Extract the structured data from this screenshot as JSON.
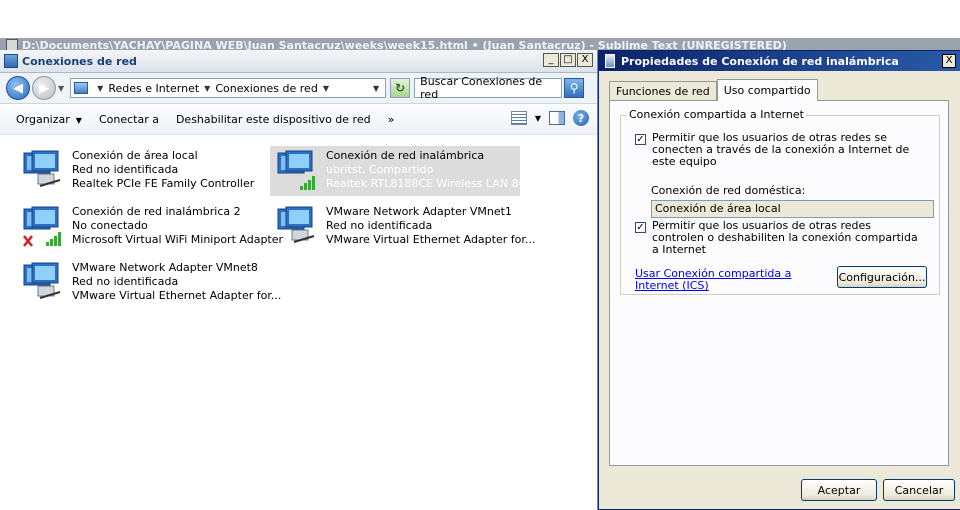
{
  "sublime": {
    "title": "D:\\Documents\\YACHAY\\PAGINA WEB\\Juan Santacruz\\weeks\\week15.html • (Juan Santacruz) - Sublime Text (UNREGISTERED)"
  },
  "explorer": {
    "title": "Conexiones de red",
    "window_buttons": {
      "minimize": "_",
      "maximize": "□",
      "close": "X"
    },
    "breadcrumb": [
      "Redes e Internet",
      "Conexiones de red"
    ],
    "search": {
      "placeholder": "Buscar Conexiones de red"
    },
    "toolbar": {
      "organize": "Organizar",
      "connect": "Conectar a",
      "disable": "Deshabilitar este dispositivo de red",
      "more": "»"
    },
    "connections": [
      {
        "name": "Conexión de área local",
        "status": "Red no identificada",
        "adapter": "Realtek PCIe FE Family Controller",
        "selected": false,
        "icon": "wired-network-icon"
      },
      {
        "name": "Conexión de red inalámbrica",
        "status": "ubritst, Compartido",
        "adapter": "Realtek RTL8188CE Wireless LAN 80...",
        "selected": true,
        "icon": "wireless-network-icon"
      },
      {
        "name": "Conexión de red inalámbrica 2",
        "status": "No conectado",
        "adapter": "Microsoft Virtual WiFi Miniport Adapter",
        "selected": false,
        "icon": "wireless-disconnected-icon"
      },
      {
        "name": "VMware Network Adapter VMnet1",
        "status": "Red no identificada",
        "adapter": "VMware Virtual Ethernet Adapter for...",
        "selected": false,
        "icon": "wired-network-icon"
      },
      {
        "name": "VMware Network Adapter VMnet8",
        "status": "Red no identificada",
        "adapter": "VMware Virtual Ethernet Adapter for...",
        "selected": false,
        "icon": "wired-network-icon"
      }
    ]
  },
  "dialog": {
    "title": "Propiedades de Conexión de red inalámbrica",
    "close": "X",
    "tabs": [
      "Funciones de red",
      "Uso compartido"
    ],
    "active_tab": 1,
    "group_title": "Conexión compartida a Internet",
    "allow_share_label": "Permitir que los usuarios de otras redes se conecten a través de la conexión a Internet de este equipo",
    "allow_share_checked": true,
    "home_network_label": "Conexión de red doméstica:",
    "home_network_value": "Conexión de área local",
    "allow_control_label": "Permitir que los usuarios de otras redes controlen o deshabiliten la conexión compartida a Internet",
    "allow_control_checked": true,
    "ics_link": "Usar Conexión compartida a Internet (ICS)",
    "config_button": "Configuración...",
    "ok_button": "Aceptar",
    "cancel_button": "Cancelar"
  }
}
